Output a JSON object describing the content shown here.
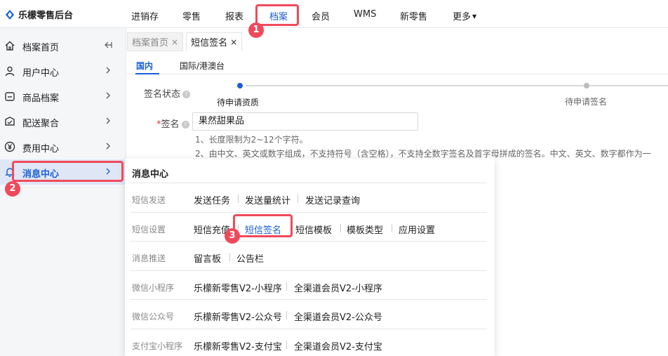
{
  "app": {
    "title": "乐檬零售后台",
    "brand_color": "#1a5fd8",
    "highlight_color": "#ef4a5c"
  },
  "top_nav": [
    {
      "label": "进销存"
    },
    {
      "label": "零售"
    },
    {
      "label": "报表"
    },
    {
      "label": "档案",
      "active": true
    },
    {
      "label": "会员"
    },
    {
      "label": "WMS"
    },
    {
      "label": "新零售"
    },
    {
      "label": "更多"
    }
  ],
  "sidebar": {
    "collapse_icon": "collapse-left-icon",
    "items": [
      {
        "label": "档案首页",
        "icon": "home-icon"
      },
      {
        "label": "用户中心",
        "icon": "user-icon"
      },
      {
        "label": "商品档案",
        "icon": "product-icon"
      },
      {
        "label": "配送聚合",
        "icon": "delivery-icon"
      },
      {
        "label": "费用中心",
        "icon": "yen-icon"
      },
      {
        "label": "消息中心",
        "icon": "bell-icon",
        "active": true
      }
    ]
  },
  "tabs": [
    {
      "label": "档案首页",
      "close": "×"
    },
    {
      "label": "短信签名",
      "close": "×",
      "active": true
    }
  ],
  "sub_tabs": [
    {
      "label": "国内",
      "active": true
    },
    {
      "label": "国际/港澳台"
    }
  ],
  "form": {
    "status_label": "签名状态",
    "steps": [
      {
        "label": "待申请资质",
        "state": "active"
      },
      {
        "label": "待申请签名",
        "state": "pending"
      }
    ],
    "sign_required": "*",
    "sign_label": "签名",
    "sign_value": "果然甜果品",
    "hints": [
      "1、长度限制为2~12个字符。",
      "2、由中文、英文或数字组成，不支持符号（含空格），不支持全数字签名及首字母拼成的签名。中文、英文、数字都作为一"
    ]
  },
  "dropdown": {
    "title": "消息中心",
    "rows": [
      {
        "label": "短信发送",
        "links": [
          "发送任务",
          "发送量统计",
          "发送记录查询"
        ]
      },
      {
        "label": "短信设置",
        "links": [
          "短信充值",
          "短信签名",
          "短信模板",
          "模板类型",
          "应用设置"
        ],
        "active_index": 1
      },
      {
        "label": "消息推送",
        "links": [
          "留言板",
          "公告栏"
        ]
      },
      {
        "label": "微信小程序",
        "links": [
          "乐檬新零售V2-小程序",
          "全渠道会员V2-小程序"
        ]
      },
      {
        "label": "微信公众号",
        "links": [
          "乐檬新零售V2-公众号",
          "全渠道会员V2-公众号"
        ]
      },
      {
        "label": "支付宝小程序",
        "links": [
          "乐檬新零售V2-支付宝",
          "全渠道会员V2-支付宝"
        ]
      }
    ]
  },
  "annotations": [
    {
      "number": "1"
    },
    {
      "number": "2"
    },
    {
      "number": "3"
    }
  ]
}
